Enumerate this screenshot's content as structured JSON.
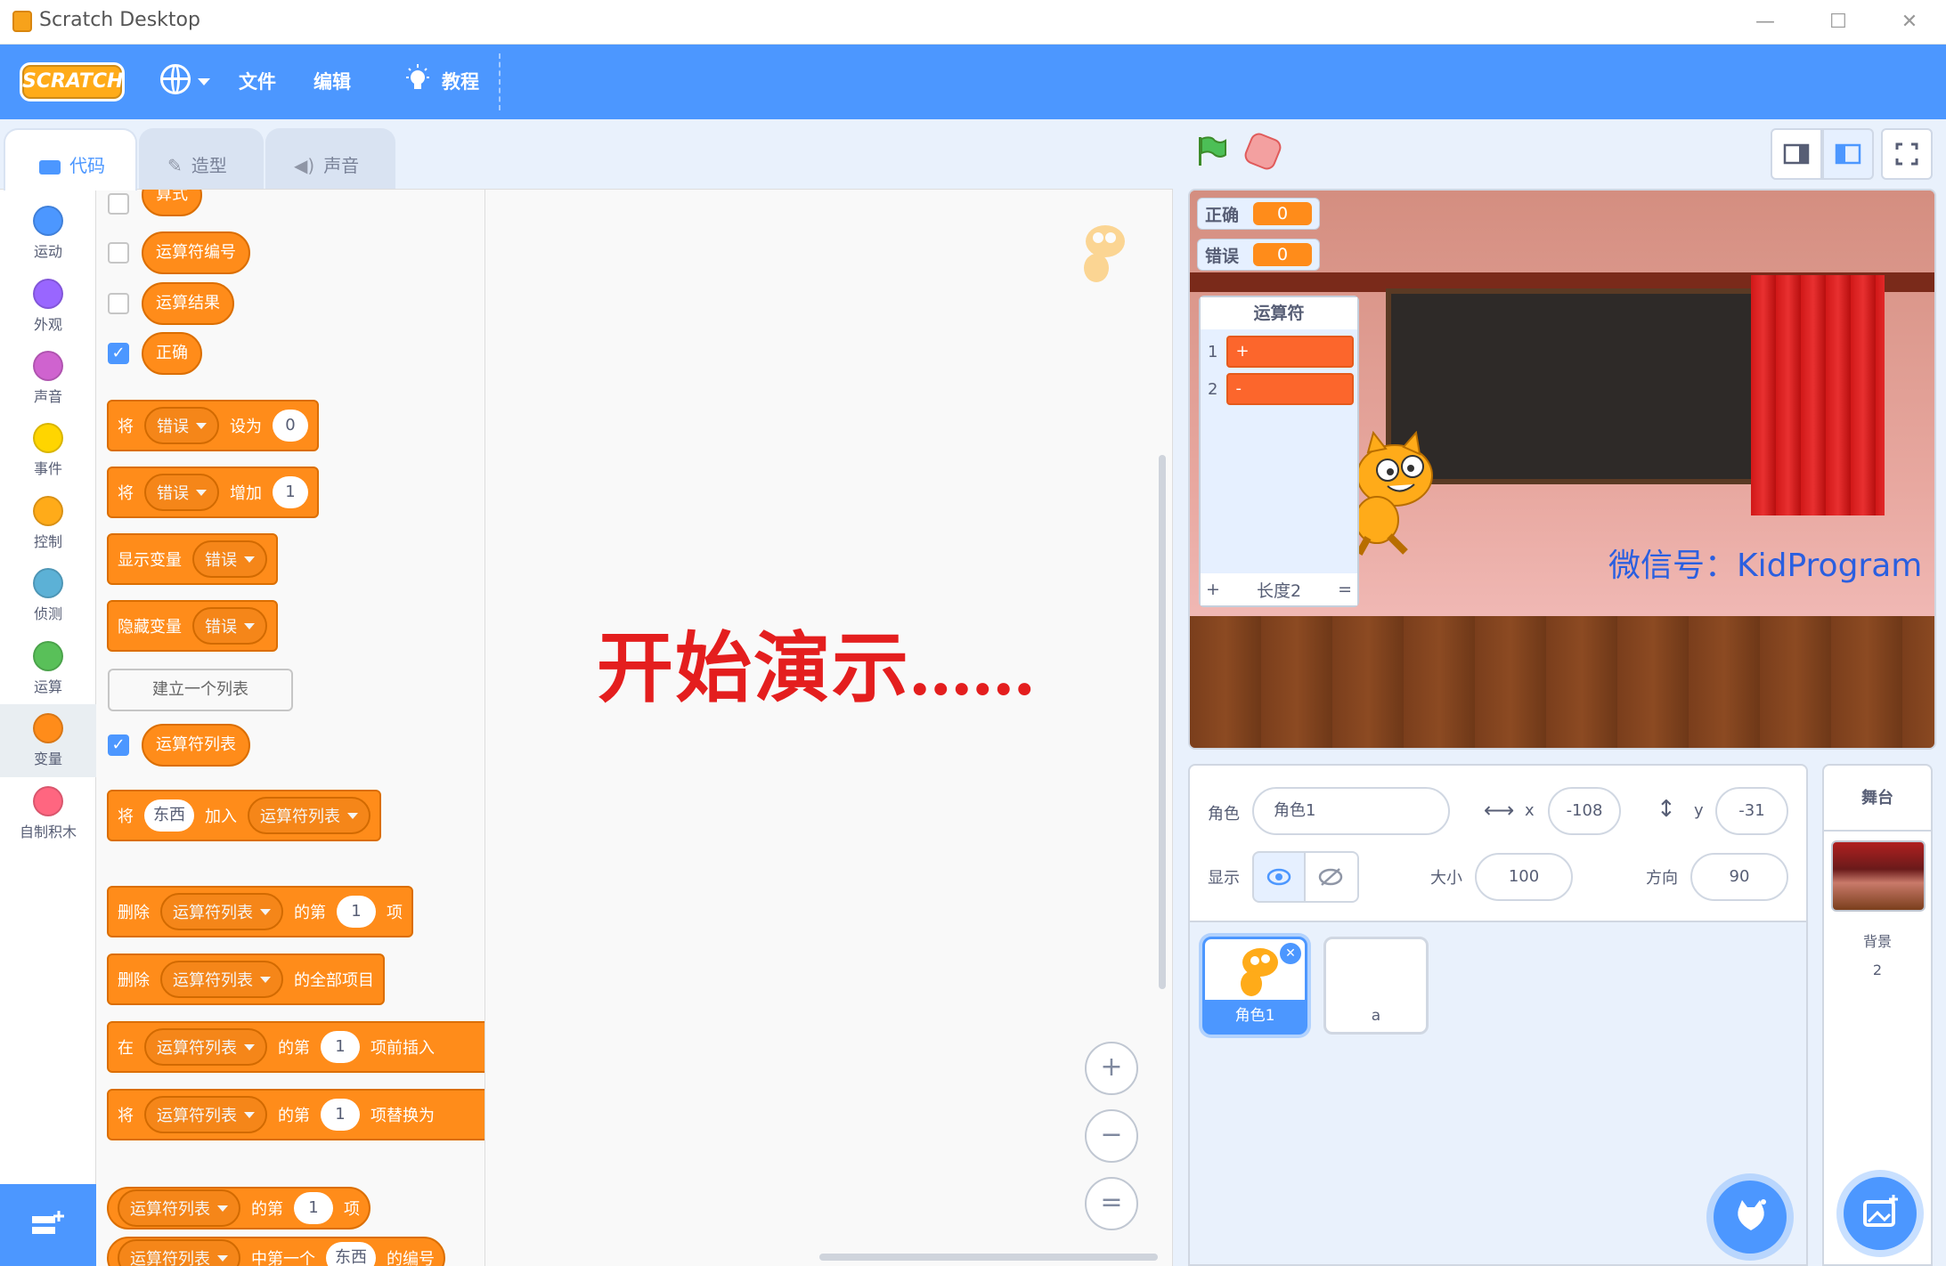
{
  "window": {
    "title": "Scratch Desktop",
    "minimize": "—",
    "maximize": "☐",
    "close": "✕"
  },
  "menu": {
    "logo": "SCRATCH",
    "file": "文件",
    "edit": "编辑",
    "tutorials": "教程"
  },
  "tabs": {
    "code": "代码",
    "costumes": "造型",
    "sounds": "声音"
  },
  "categories": [
    {
      "label": "运动",
      "color": "#4c97ff"
    },
    {
      "label": "外观",
      "color": "#9966ff"
    },
    {
      "label": "声音",
      "color": "#cf63cf"
    },
    {
      "label": "事件",
      "color": "#ffd500"
    },
    {
      "label": "控制",
      "color": "#ffab19"
    },
    {
      "label": "侦测",
      "color": "#5cb1d6"
    },
    {
      "label": "运算",
      "color": "#59c059"
    },
    {
      "label": "变量",
      "color": "#ff8c1a"
    },
    {
      "label": "自制积木",
      "color": "#ff6680"
    }
  ],
  "palette": {
    "var1": "算式",
    "var2": "运算符编号",
    "var3": "运算结果",
    "var4": "正确",
    "set_block": {
      "kw": "将",
      "var": "错误",
      "mid": "设为",
      "val": "0"
    },
    "change_block": {
      "kw": "将",
      "var": "错误",
      "mid": "增加",
      "val": "1"
    },
    "show_block": {
      "kw": "显示变量",
      "var": "错误"
    },
    "hide_block": {
      "kw": "隐藏变量",
      "var": "错误"
    },
    "make_list": "建立一个列表",
    "list_reporter": "运算符列表",
    "add_block": {
      "kw": "将",
      "val": "东西",
      "mid": "加入",
      "list": "运算符列表"
    },
    "delete_block": {
      "kw": "删除",
      "list": "运算符列表",
      "mid": "的第",
      "val": "1",
      "end": "项"
    },
    "delete_all": {
      "kw": "删除",
      "list": "运算符列表",
      "end": "的全部项目"
    },
    "insert_block": {
      "kw": "在",
      "list": "运算符列表",
      "mid": "的第",
      "val": "1",
      "end": "项前插入"
    },
    "replace_block": {
      "kw": "将",
      "list": "运算符列表",
      "mid": "的第",
      "val": "1",
      "end": "项替换为"
    },
    "item_reporter": {
      "list": "运算符列表",
      "mid": "的第",
      "val": "1",
      "end": "项"
    },
    "index_reporter": {
      "list": "运算符列表",
      "mid": "中第一个",
      "val": "东西",
      "end": "的编号"
    }
  },
  "scripts": {
    "overlay_text": "开始演示......",
    "zoom_in": "+",
    "zoom_out": "−",
    "zoom_reset": "="
  },
  "stage": {
    "monitors": [
      {
        "label": "正确",
        "value": "0"
      },
      {
        "label": "错误",
        "value": "0"
      }
    ],
    "list_monitor": {
      "title": "运算符",
      "items": [
        {
          "index": "1",
          "value": "+"
        },
        {
          "index": "2",
          "value": "-"
        }
      ],
      "add": "+",
      "length": "长度2",
      "resize": "="
    },
    "watermark": "微信号：KidProgram"
  },
  "sprite_info": {
    "sprite_label": "角色",
    "sprite_name": "角色1",
    "x_label": "x",
    "x": "-108",
    "y_label": "y",
    "y": "-31",
    "show_label": "显示",
    "size_label": "大小",
    "size": "100",
    "direction_label": "方向",
    "direction": "90"
  },
  "sprites": [
    {
      "name": "角色1"
    },
    {
      "name": "a"
    }
  ],
  "stage_panel": {
    "title": "舞台",
    "backdrop_label": "背景",
    "backdrop_count": "2"
  }
}
